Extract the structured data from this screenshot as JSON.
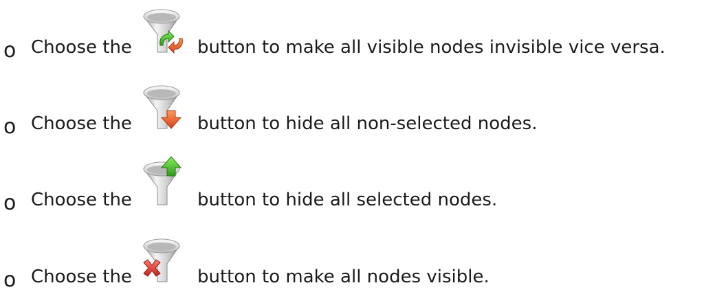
{
  "bullet_glyph": "o",
  "items": [
    {
      "prefix": "Choose the",
      "suffix": "button to make all visible nodes invisible vice versa.",
      "icon": "funnel-invert-icon"
    },
    {
      "prefix": "Choose the",
      "suffix": "button to hide all non-selected nodes.",
      "icon": "funnel-down-arrow-icon"
    },
    {
      "prefix": "Choose the",
      "suffix": "button to hide all selected nodes.",
      "icon": "funnel-up-arrow-icon"
    },
    {
      "prefix": "Choose the",
      "suffix": "button to make all nodes visible.",
      "icon": "funnel-clear-icon"
    }
  ],
  "colors": {
    "text": "#1a1a1a",
    "funnel_light": "#e6e6e6",
    "funnel_dark": "#8f8f8f",
    "green": "#3fbf2f",
    "orange": "#e8542a",
    "red": "#d62f2f"
  }
}
